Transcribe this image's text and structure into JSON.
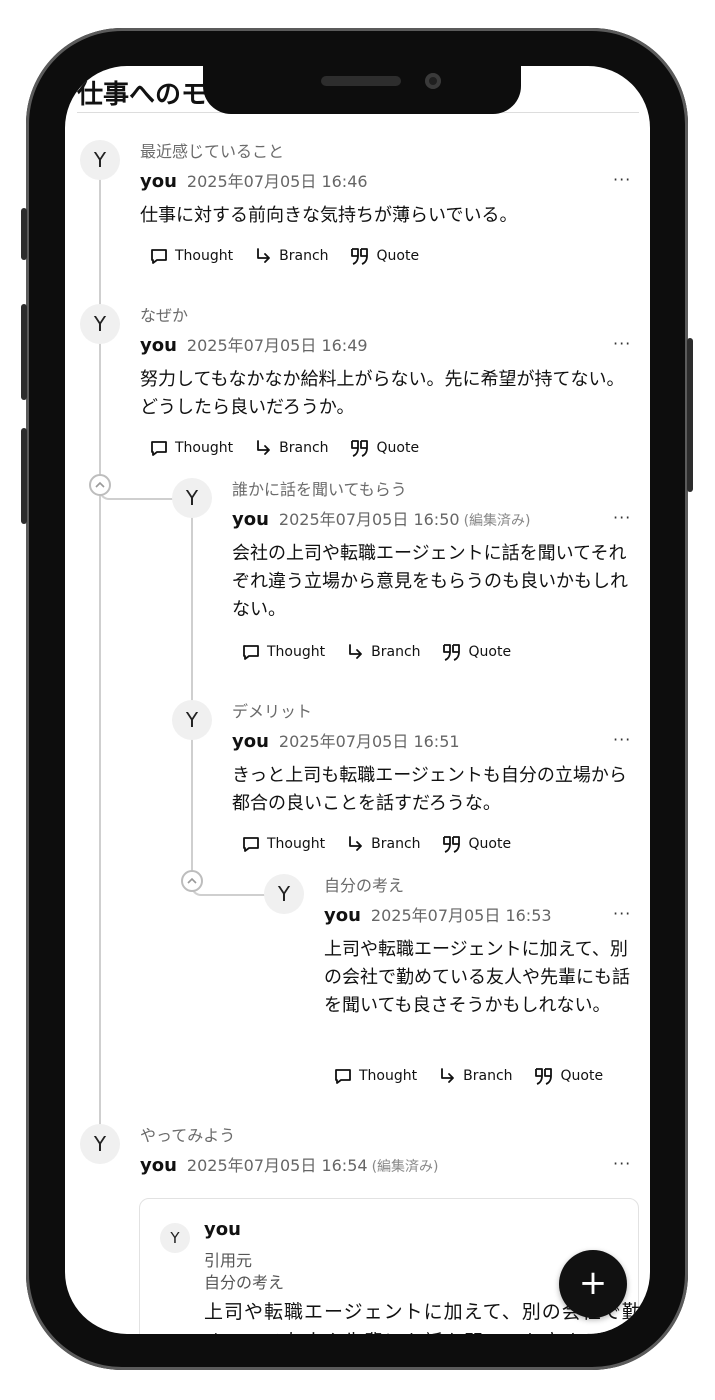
{
  "header": {
    "title": "仕事へのモ"
  },
  "actions": {
    "thought": "Thought",
    "branch": "Branch",
    "quote": "Quote"
  },
  "posts": [
    {
      "avatar": "Y",
      "subject": "最近感じていること",
      "author": "you",
      "timestamp": "2025年07月05日 16:46",
      "edited": "",
      "body": "仕事に対する前向きな気持ちが薄らいでいる。"
    },
    {
      "avatar": "Y",
      "subject": "なぜか",
      "author": "you",
      "timestamp": "2025年07月05日 16:49",
      "edited": "",
      "body": "努力してもなかなか給料上がらない。先に希望が持てない。どうしたら良いだろうか。"
    },
    {
      "avatar": "Y",
      "subject": "誰かに話を聞いてもらう",
      "author": "you",
      "timestamp": "2025年07月05日 16:50",
      "edited": "(編集済み)",
      "body": "会社の上司や転職エージェントに話を聞いてそれぞれ違う立場から意見をもらうのも良いかもしれない。"
    },
    {
      "avatar": "Y",
      "subject": "デメリット",
      "author": "you",
      "timestamp": "2025年07月05日 16:51",
      "edited": "",
      "body": "きっと上司も転職エージェントも自分の立場から都合の良いことを話すだろうな。"
    },
    {
      "avatar": "Y",
      "subject": "自分の考え",
      "author": "you",
      "timestamp": "2025年07月05日 16:53",
      "edited": "",
      "body": "上司や転職エージェントに加えて、別の会社で勤めている友人や先輩にも話を聞いても良さそうかもしれない。"
    },
    {
      "avatar": "Y",
      "subject": "やってみよう",
      "author": "you",
      "timestamp": "2025年07月05日 16:54",
      "edited": "(編集済み)",
      "body": ""
    }
  ],
  "quote_card": {
    "avatar": "Y",
    "author": "you",
    "source_label": "引用元",
    "source_title": "自分の考え",
    "text": "上司や転職エージェントに加えて、別の会社で勤めている友人や先輩にも話を聞いても良さそうかもしれない。"
  },
  "more_label": "···",
  "fab": {
    "label": "+"
  },
  "icons": [
    "comment-icon",
    "branch-arrow-icon",
    "quote-icon",
    "collapse-chevron-icon",
    "plus-icon"
  ]
}
